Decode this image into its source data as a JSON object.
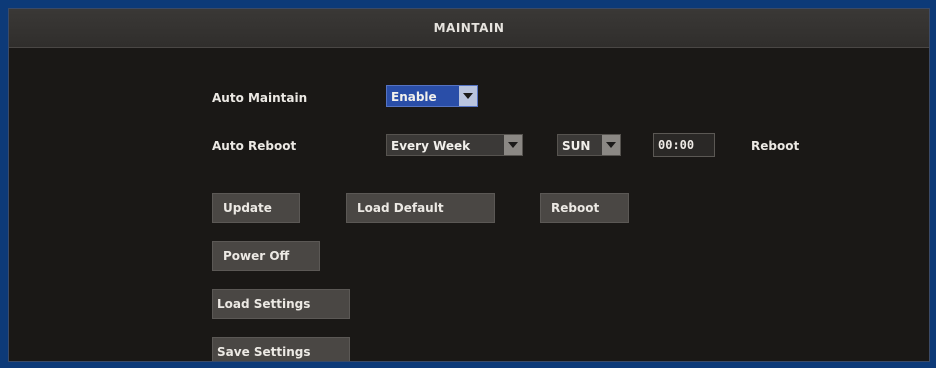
{
  "window": {
    "title": "MAINTAIN"
  },
  "auto_maintain": {
    "label": "Auto Maintain",
    "value": "Enable"
  },
  "auto_reboot": {
    "label": "Auto Reboot",
    "frequency": "Every Week",
    "day": "SUN",
    "time": "00:00",
    "suffix": "Reboot"
  },
  "buttons": {
    "update": "Update",
    "load_default": "Load Default",
    "reboot": "Reboot",
    "power_off": "Power Off",
    "load_settings": "Load Settings",
    "save_settings": "Save Settings"
  },
  "colors": {
    "outer_frame": "#0d3a78",
    "panel_bg": "#1a1816",
    "title_bar": "#35332f",
    "button_bg": "#4a4744",
    "selected_dropdown": "#2a4ea8"
  }
}
